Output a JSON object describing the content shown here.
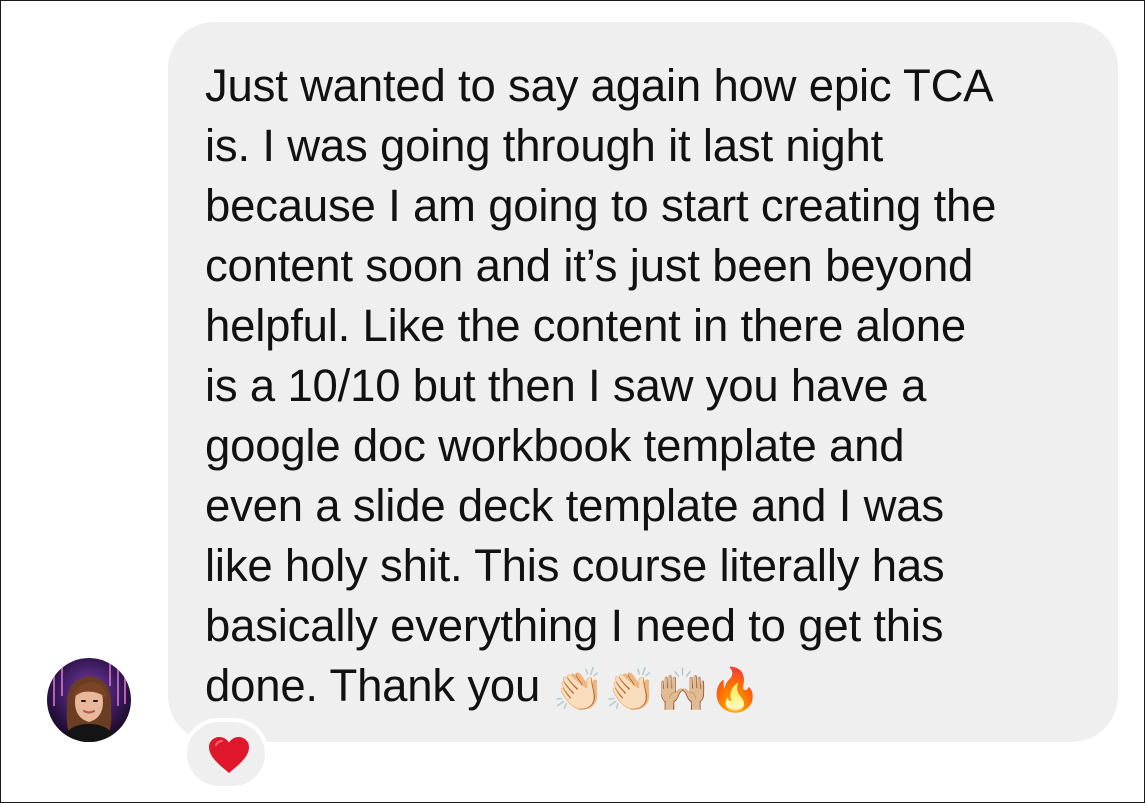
{
  "message": {
    "lines": [
      "Just wanted to say again how epic TCA",
      "is. I was going through it last night",
      "because I am going to start creating the",
      "content soon and it’s just been beyond",
      "helpful. Like the content in there alone",
      "is a 10/10 but then I saw you have a",
      "google doc workbook template and",
      "even a slide deck template and I was",
      "like holy shit. This course literally has",
      "basically everything I need to get this",
      "done. Thank you"
    ],
    "emojis": [
      "👏🏻",
      "👏🏻",
      "🙌🏼",
      "🔥"
    ]
  },
  "sender": {
    "avatar_icon": "profile-photo"
  },
  "reaction": {
    "icon": "red-heart-icon",
    "color": "#e0162b"
  },
  "colors": {
    "bubble": "#efeff0",
    "text": "#111111",
    "background": "#ffffff"
  }
}
